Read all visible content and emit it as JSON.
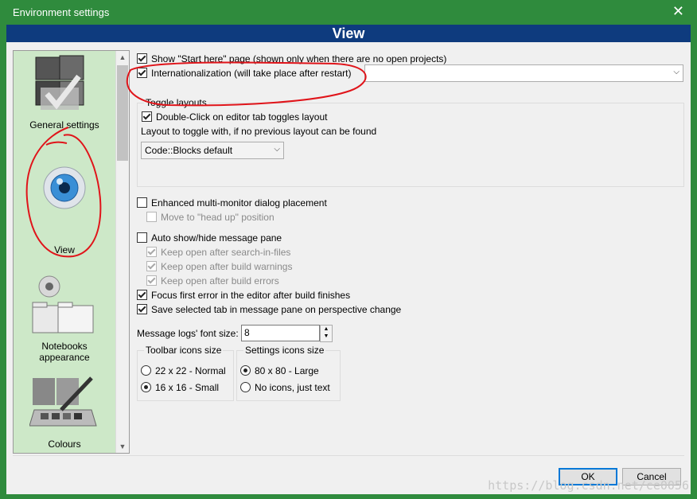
{
  "window": {
    "title": "Environment settings",
    "close_glyph": "✕"
  },
  "banner": {
    "title": "View"
  },
  "sidebar": {
    "items": [
      {
        "label": "General settings",
        "icon": "general-settings-icon"
      },
      {
        "label": "View",
        "icon": "eye-icon"
      },
      {
        "label": "Notebooks appearance",
        "label_line1": "Notebooks",
        "label_line2": "appearance",
        "icon": "folders-icon"
      },
      {
        "label": "Colours",
        "icon": "palette-icon"
      }
    ],
    "scroll_up": "▲",
    "scroll_down": "▼"
  },
  "options": {
    "show_start_here": {
      "label": "Show \"Start here\" page (shown only when there are no open projects)",
      "checked": true
    },
    "internationalization": {
      "label": "Internationalization (will take place after restart)",
      "checked": true,
      "value": ""
    },
    "toggle_layouts": {
      "title": "Toggle layouts",
      "double_click": {
        "label": "Double-Click on editor tab toggles layout",
        "checked": true
      },
      "layout_prompt": "Layout to toggle with, if no previous layout can be found",
      "layout_value": "Code::Blocks default"
    },
    "enhanced_multimonitor": {
      "label": "Enhanced multi-monitor dialog placement",
      "checked": false
    },
    "move_head_up": {
      "label": "Move to \"head up\" position",
      "checked": false,
      "disabled": true
    },
    "auto_show_hide": {
      "label": "Auto show/hide message pane",
      "checked": false
    },
    "keep_search": {
      "label": "Keep open after search-in-files",
      "checked": true,
      "disabled": true
    },
    "keep_build_warnings": {
      "label": "Keep open after build warnings",
      "checked": true,
      "disabled": true
    },
    "keep_build_errors": {
      "label": "Keep open after build errors",
      "checked": true,
      "disabled": true
    },
    "focus_first_error": {
      "label": "Focus first error in the editor after build finishes",
      "checked": true
    },
    "save_selected_tab": {
      "label": "Save selected tab in message pane on perspective change",
      "checked": true
    },
    "font_size": {
      "label": "Message logs' font size:",
      "value": "8"
    },
    "toolbar_icons": {
      "title": "Toolbar icons size",
      "options": [
        {
          "label": "22 x 22 - Normal",
          "selected": false
        },
        {
          "label": "16 x 16 - Small",
          "selected": true
        }
      ]
    },
    "settings_icons": {
      "title": "Settings icons size",
      "options": [
        {
          "label": "80 x 80 - Large",
          "selected": true
        },
        {
          "label": "No icons, just text",
          "selected": false
        }
      ]
    }
  },
  "buttons": {
    "ok": "OK",
    "cancel": "Cancel"
  },
  "watermark": "https://blog.csdn.net/ce0056",
  "colors": {
    "titlebar": "#2f8b3d",
    "banner": "#0e3b7e",
    "sidebar_bg": "#cde8c8",
    "annotation": "#e0141a"
  }
}
